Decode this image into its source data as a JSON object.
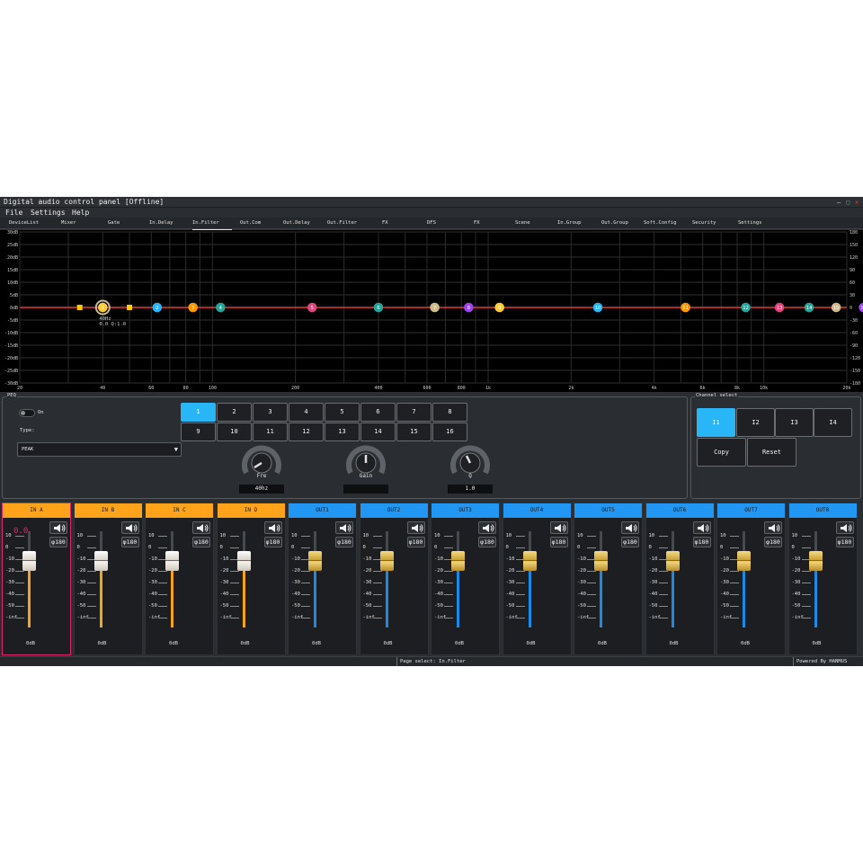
{
  "window": {
    "title": "Digital audio control panel [Offline]",
    "controls": [
      "–",
      "▢",
      "✕"
    ]
  },
  "menu": [
    "File",
    "Settings",
    "Help"
  ],
  "tabs": [
    "DeviceList",
    "Mixer",
    "Gate",
    "In.Delay",
    "In.Filter",
    "Out.Com",
    "Out.Delay",
    "Out.Filter",
    "FX",
    "DFS",
    "FX",
    "Scene",
    "In.Group",
    "Out.Group",
    "Soft.Config",
    "Security",
    "Settings"
  ],
  "active_tab": "In.Filter",
  "graph": {
    "y_left_labels": [
      "30dB",
      "25dB",
      "20dB",
      "15dB",
      "10dB",
      "5dB",
      "0dB",
      "-5dB",
      "-10dB",
      "-15dB",
      "-20dB",
      "-25dB",
      "-30dB"
    ],
    "y_right_labels": [
      "180",
      "150",
      "120",
      "90",
      "60",
      "30",
      "0",
      "-30",
      "-60",
      "-90",
      "-120",
      "-150",
      "-180"
    ],
    "x_labels": [
      "20",
      "40",
      "60",
      "80",
      "100",
      "200",
      "400",
      "600",
      "800",
      "1k",
      "2k",
      "4k",
      "6k",
      "8k",
      "10k",
      "20k"
    ],
    "x_values": [
      20,
      40,
      60,
      80,
      100,
      200,
      400,
      600,
      800,
      1000,
      2000,
      4000,
      6000,
      8000,
      10000,
      20000
    ],
    "curve_color": "#e53935",
    "markers": [
      {
        "id": "1",
        "freq": 40,
        "color": "#ffcc33"
      },
      {
        "id": "2",
        "freq": 63,
        "color": "#29b6f6"
      },
      {
        "id": "3",
        "freq": 85,
        "color": "#ff9800"
      },
      {
        "id": "4",
        "freq": 107,
        "color": "#26a69a"
      },
      {
        "id": "5",
        "freq": 230,
        "color": "#e0457b"
      },
      {
        "id": "6",
        "freq": 400,
        "color": "#26a69a"
      },
      {
        "id": "7",
        "freq": 640,
        "color": "#cdbb8a"
      },
      {
        "id": "8",
        "freq": 850,
        "color": "#a142f4"
      },
      {
        "id": "9",
        "freq": 1100,
        "color": "#ffcc33"
      },
      {
        "id": "10",
        "freq": 2500,
        "color": "#29b6f6"
      },
      {
        "id": "11",
        "freq": 5200,
        "color": "#ff9800"
      },
      {
        "id": "12",
        "freq": 8600,
        "color": "#26a69a"
      },
      {
        "id": "13",
        "freq": 11400,
        "color": "#e0457b"
      },
      {
        "id": "14",
        "freq": 14600,
        "color": "#26a69a"
      },
      {
        "id": "15",
        "freq": 18300,
        "color": "#cdbb8a"
      },
      {
        "id": "16",
        "freq": 23000,
        "color": "#a142f4"
      }
    ],
    "square_markers": [
      {
        "freq": 33,
        "color": "#ffcc00"
      },
      {
        "freq": 50,
        "color": "#ffcc00"
      }
    ],
    "selected_label": [
      "40Hz",
      "0.0 Q:1.0"
    ]
  },
  "peq": {
    "title": "PEQ",
    "on_label": "On",
    "type_label": "Type:",
    "type_value": "PEAK",
    "filters": [
      "1",
      "2",
      "3",
      "4",
      "5",
      "6",
      "7",
      "8",
      "9",
      "10",
      "11",
      "12",
      "13",
      "14",
      "15",
      "16"
    ],
    "selected_filter": "1",
    "knobs": [
      {
        "label": "Fre",
        "value": "40hz"
      },
      {
        "label": "Gain",
        "value": ""
      },
      {
        "label": "Q",
        "value": "1.0"
      }
    ]
  },
  "channel_select": {
    "title": "Channel select",
    "channels": [
      "I1",
      "I2",
      "I3",
      "I4"
    ],
    "selected": "I1",
    "copy_label": "Copy",
    "reset_label": "Reset"
  },
  "strips": [
    {
      "name": "IN A",
      "phase": "180",
      "db": "0dB",
      "type": "in",
      "gain_display": "0.0"
    },
    {
      "name": "IN B",
      "phase": "180",
      "db": "0dB",
      "type": "in"
    },
    {
      "name": "IN C",
      "phase": "180",
      "db": "0dB",
      "type": "in"
    },
    {
      "name": "IN D",
      "phase": "180",
      "db": "0dB",
      "type": "in"
    },
    {
      "name": "OUT1",
      "phase": "180",
      "db": "0dB",
      "type": "out"
    },
    {
      "name": "OUT2",
      "phase": "180",
      "db": "0dB",
      "type": "out"
    },
    {
      "name": "OUT3",
      "phase": "180",
      "db": "0dB",
      "type": "out"
    },
    {
      "name": "OUT4",
      "phase": "180",
      "db": "0dB",
      "type": "out"
    },
    {
      "name": "OUT5",
      "phase": "180",
      "db": "0dB",
      "type": "out"
    },
    {
      "name": "OUT6",
      "phase": "180",
      "db": "0dB",
      "type": "out"
    },
    {
      "name": "OUT7",
      "phase": "180",
      "db": "0dB",
      "type": "out"
    },
    {
      "name": "OUT8",
      "phase": "180",
      "db": "0dB",
      "type": "out"
    }
  ],
  "fader_scale": [
    "10",
    "0",
    "-10",
    "-20",
    "-30",
    "-40",
    "-50",
    "-inf"
  ],
  "fader_level_db": 0,
  "colors": {
    "in_header": "#ffa31a",
    "out_header": "#2196f3",
    "in_fill": "#f5a51b",
    "out_fill": "#1e88e5",
    "highlight": "#e2246b",
    "in_cap": "#f0ece6",
    "out_cap": "#e8c460"
  },
  "status": {
    "page": "Page select: In.Filter",
    "powered": "Powered By HANMUS"
  }
}
